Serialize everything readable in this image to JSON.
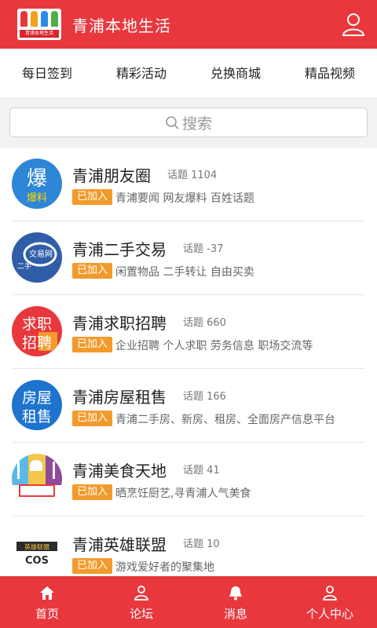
{
  "header": {
    "title": "青浦本地生活",
    "logo_text": "青浦本地生活",
    "user_icon": "user-icon"
  },
  "topnav": {
    "tabs": [
      "每日签到",
      "精彩活动",
      "兑换商城",
      "精品视频"
    ]
  },
  "search": {
    "placeholder": "搜索",
    "icon": "search-icon"
  },
  "topics": [
    {
      "name": "青浦朋友圈",
      "count_label": "话题 1104",
      "badge": "已加入",
      "desc": "青浦要闻 网友爆料 百姓话题",
      "avatar_text": [
        "爆",
        "爆料"
      ],
      "color": "#2e86d6"
    },
    {
      "name": "青浦二手交易",
      "count_label": "话题 -37",
      "badge": "已加入",
      "desc": "闲置物品 二手转让 自由买卖",
      "avatar_text": [
        "交易网",
        "二手"
      ],
      "color": "#2f5da8"
    },
    {
      "name": "青浦求职招聘",
      "count_label": "话题 660",
      "badge": "已加入",
      "desc": "企业招聘 个人求职 劳务信息 职场交流等",
      "avatar_text": [
        "求职",
        "招聘"
      ],
      "color": "#e8383d"
    },
    {
      "name": "青浦房屋租售",
      "count_label": "话题 166",
      "badge": "已加入",
      "desc": "青浦二手房、新房、租房、全面房产信息平台",
      "avatar_text": [
        "房屋",
        "租售"
      ],
      "color": "#1e73cf"
    },
    {
      "name": "青浦美食天地",
      "count_label": "话题 41",
      "badge": "已加入",
      "desc": "晒烹饪厨艺,寻青浦人气美食",
      "avatar_text": [],
      "color": "#f4c64a"
    },
    {
      "name": "青浦英雄联盟",
      "count_label": "话题 10",
      "badge": "已加入",
      "desc": "游戏爱好者的聚集地",
      "avatar_text": [
        "英雄联盟",
        "COS"
      ],
      "color": "#222222"
    }
  ],
  "bottomnav": {
    "items": [
      {
        "label": "首页",
        "icon": "home-icon"
      },
      {
        "label": "论坛",
        "icon": "forum-person-icon"
      },
      {
        "label": "消息",
        "icon": "bell-icon"
      },
      {
        "label": "个人中心",
        "icon": "profile-icon"
      }
    ]
  },
  "colors": {
    "brand_red": "#e8383d",
    "badge_orange": "#f39a2c"
  }
}
